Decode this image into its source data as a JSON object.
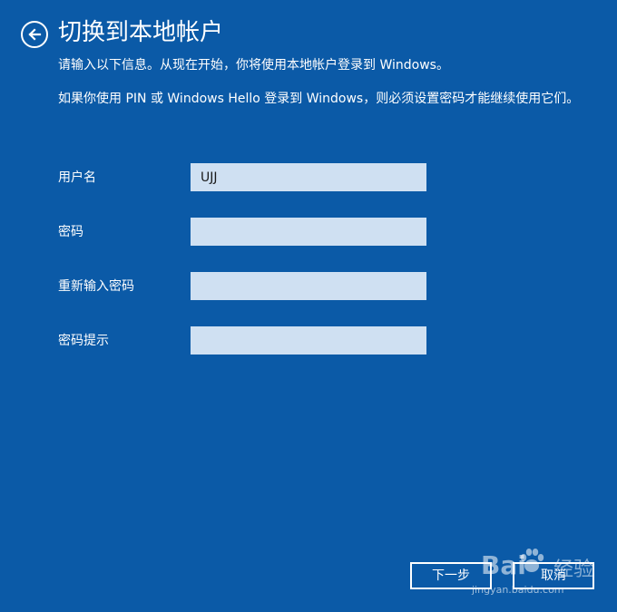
{
  "header": {
    "title": "切换到本地帐户",
    "back_icon": "back-arrow-icon"
  },
  "description": {
    "line1": "请输入以下信息。从现在开始，你将使用本地帐户登录到 Windows。",
    "line2": "如果你使用 PIN 或 Windows Hello 登录到 Windows，则必须设置密码才能继续使用它们。"
  },
  "form": {
    "username": {
      "label": "用户名",
      "value": "UJJ"
    },
    "password": {
      "label": "密码",
      "value": ""
    },
    "confirm_password": {
      "label": "重新输入密码",
      "value": ""
    },
    "password_hint": {
      "label": "密码提示",
      "value": ""
    }
  },
  "buttons": {
    "next": "下一步",
    "cancel": "取消"
  },
  "watermark": {
    "logo": "Bai  ",
    "text": "经验",
    "url": "jingyan.baidu.com"
  },
  "colors": {
    "background": "#0b5aa7",
    "input_bg": "#cfe0f2",
    "text": "#ffffff"
  }
}
